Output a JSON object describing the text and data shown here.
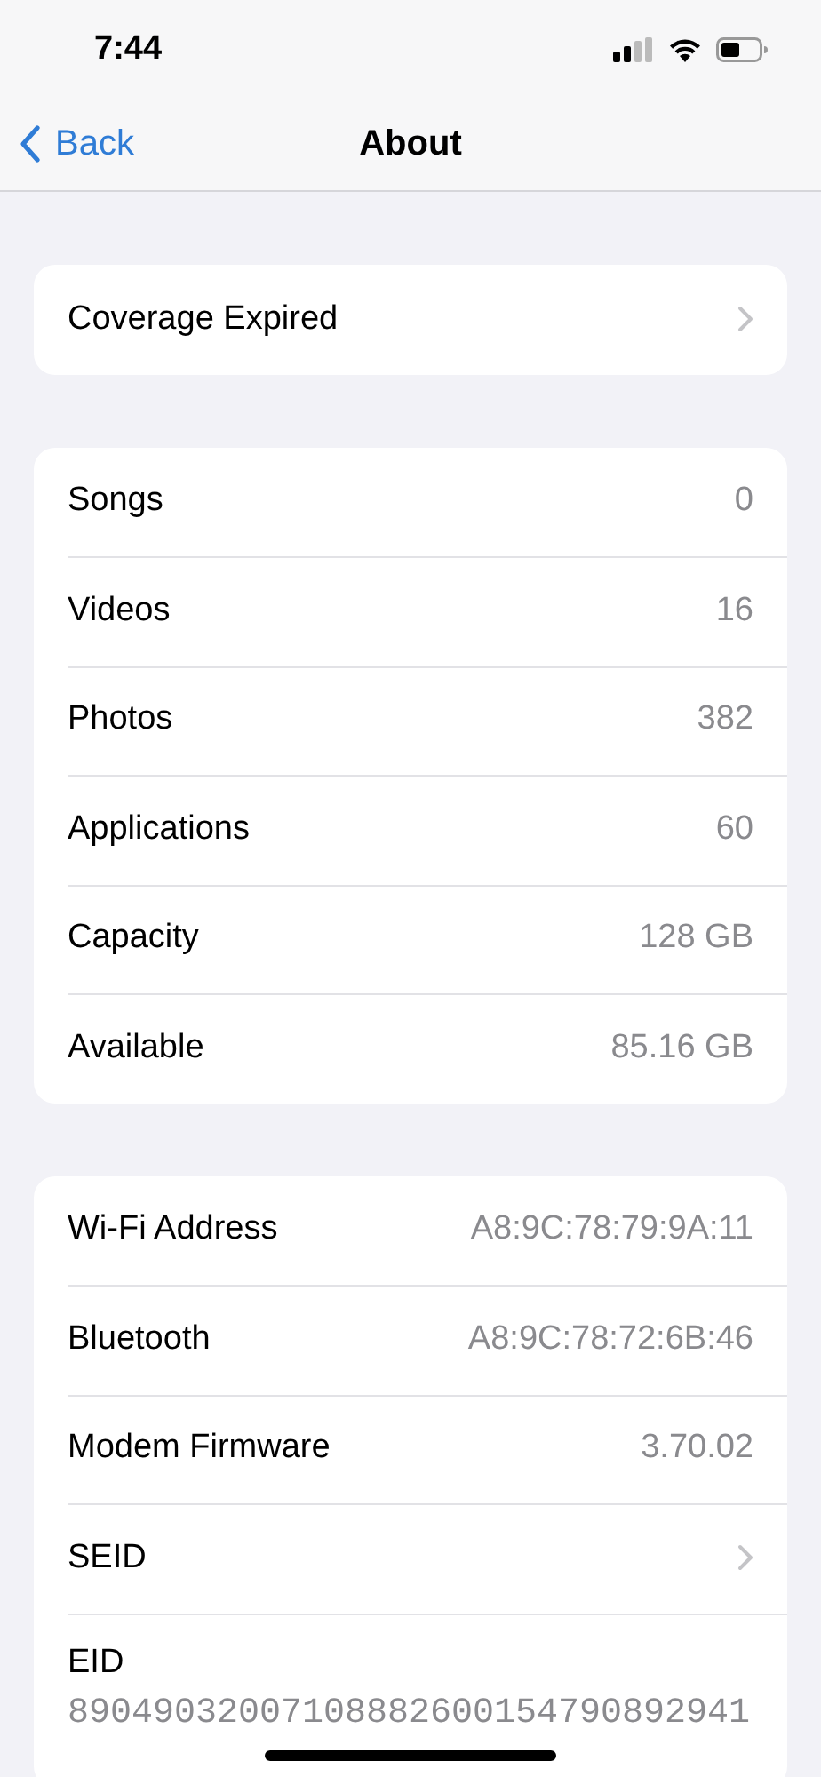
{
  "status_bar": {
    "time": "7:44"
  },
  "nav": {
    "back": "Back",
    "title": "About"
  },
  "groups": [
    {
      "rows": [
        {
          "kind": "chevron",
          "label": "Coverage Expired"
        }
      ]
    },
    {
      "rows": [
        {
          "kind": "value",
          "label": "Songs",
          "value": "0"
        },
        {
          "kind": "value",
          "label": "Videos",
          "value": "16"
        },
        {
          "kind": "value",
          "label": "Photos",
          "value": "382"
        },
        {
          "kind": "value",
          "label": "Applications",
          "value": "60"
        },
        {
          "kind": "value",
          "label": "Capacity",
          "value": "128 GB"
        },
        {
          "kind": "value",
          "label": "Available",
          "value": "85.16 GB"
        }
      ]
    },
    {
      "rows": [
        {
          "kind": "value",
          "label": "Wi-Fi Address",
          "value": "A8:9C:78:79:9A:11"
        },
        {
          "kind": "value",
          "label": "Bluetooth",
          "value": "A8:9C:78:72:6B:46"
        },
        {
          "kind": "value",
          "label": "Modem Firmware",
          "value": "3.70.02"
        },
        {
          "kind": "chevron",
          "label": "SEID"
        },
        {
          "kind": "stacked",
          "label": "EID",
          "value": "89049032007108882600154790892941"
        }
      ]
    }
  ]
}
